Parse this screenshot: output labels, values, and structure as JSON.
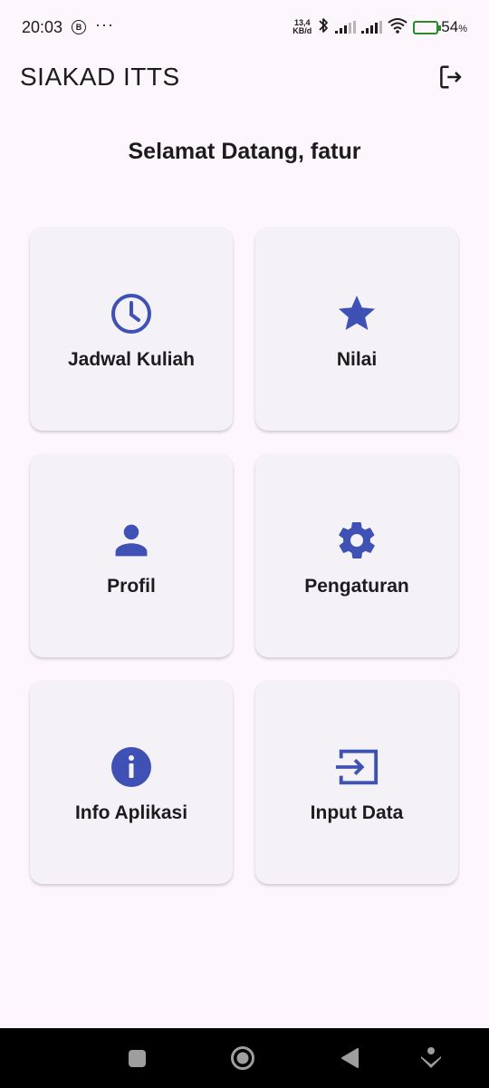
{
  "status_bar": {
    "time": "20:03",
    "b_badge": "B",
    "more": "···",
    "net_speed_value": "13,4",
    "net_speed_unit": "KB/d",
    "battery_percent": "54",
    "battery_unit": "%",
    "battery_level": 0.54
  },
  "app_bar": {
    "title": "SIAKAD ITTS",
    "logout_icon": "logout-icon"
  },
  "welcome_text": "Selamat Datang, fatur",
  "accent_color": "#3f51b5",
  "menu": [
    {
      "label": "Jadwal Kuliah",
      "icon": "clock-icon"
    },
    {
      "label": "Nilai",
      "icon": "star-icon"
    },
    {
      "label": "Profil",
      "icon": "person-icon"
    },
    {
      "label": "Pengaturan",
      "icon": "gear-icon"
    },
    {
      "label": "Info Aplikasi",
      "icon": "info-icon"
    },
    {
      "label": "Input Data",
      "icon": "input-icon"
    }
  ],
  "nav_bar": {
    "buttons": [
      "recents-icon",
      "home-icon",
      "back-icon",
      "assistant-icon"
    ]
  }
}
